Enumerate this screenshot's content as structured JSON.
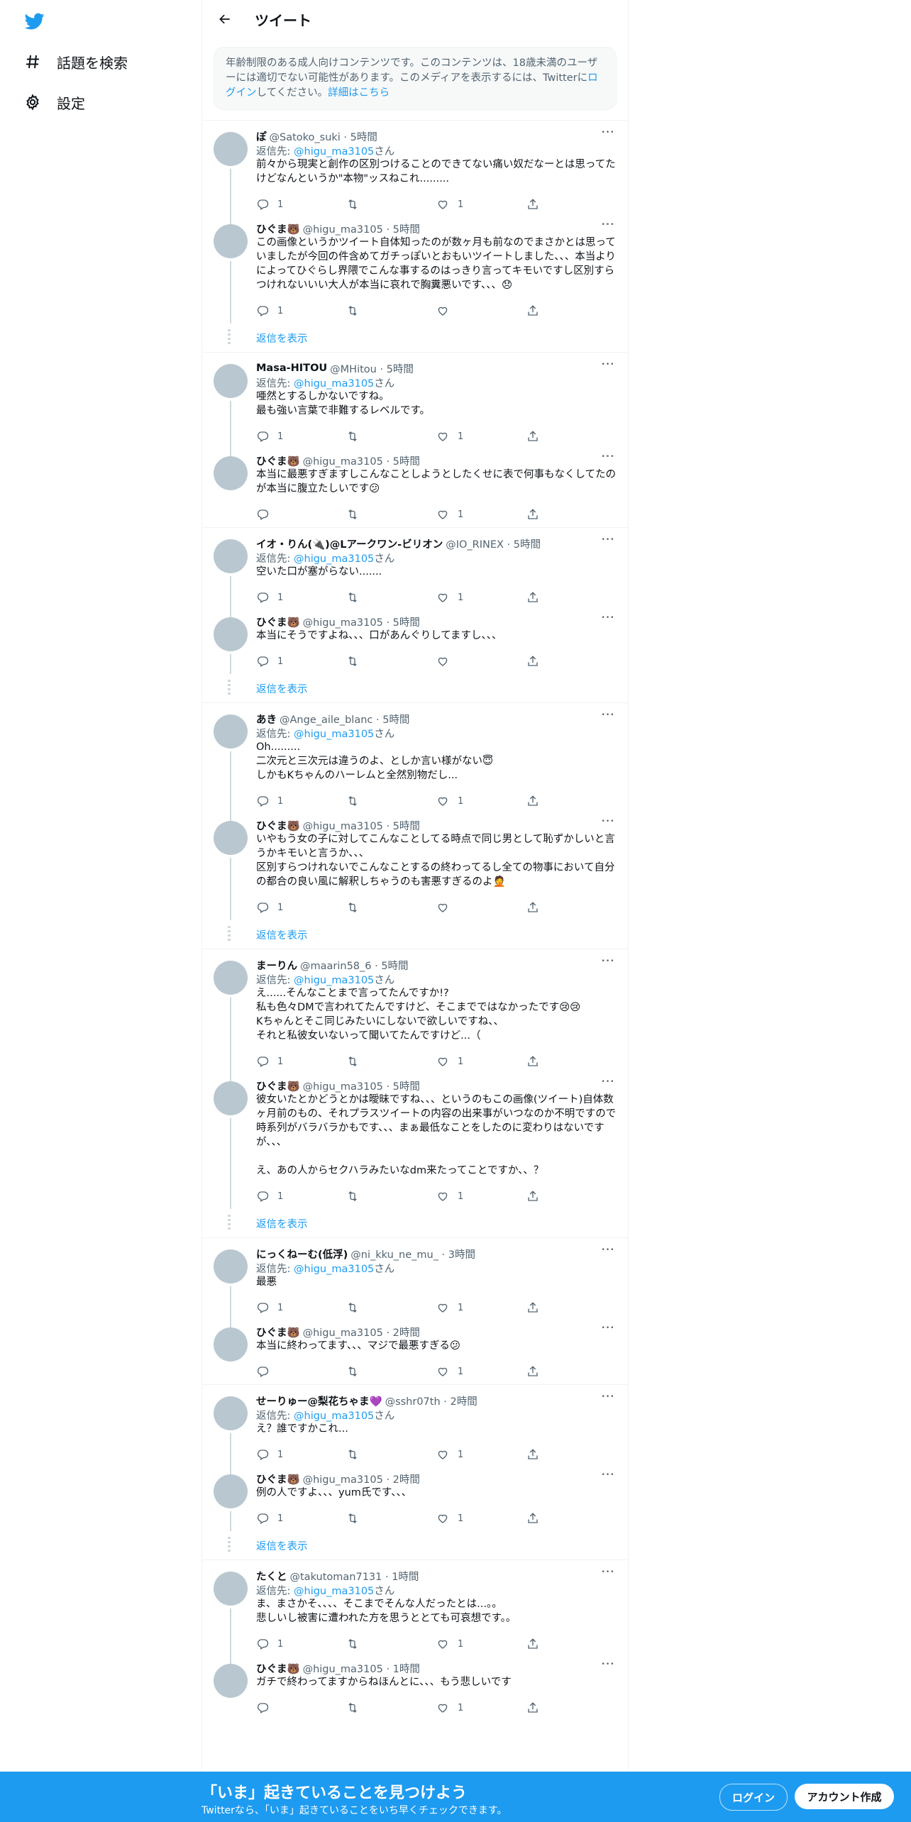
{
  "nav": {
    "search_label": "話題を検索",
    "settings_label": "設定"
  },
  "header": {
    "title": "ツイート"
  },
  "notice": {
    "text": "年齢制限のある成人向けコンテンツです。このコンテンツは、18歳未満のユーザーには適切でない可能性があります。このメディアを表示するには、Twitter",
    "prefix": "に",
    "login_link": "ログイン",
    "middle": "してください。",
    "details_link": "詳細はこちら"
  },
  "reply_prefix": "返信先: ",
  "reply_suffix": "さん",
  "show_replies": "返信を表示",
  "threads": [
    {
      "tweets": [
        {
          "name": "ぽ",
          "handle": "@Satoko_suki · 5時間",
          "reply_to": "@higu_ma3105",
          "text": "前々から現実と創作の区別つけることのできてない痛い奴だなーとは思ってたけどなんというか\"本物\"ッスねこれ.........",
          "reply_count": "1",
          "retweet_count": "",
          "like_count": "1"
        },
        {
          "name": "ひぐま🐻",
          "handle": "@higu_ma3105 · 5時間",
          "text": "この画像というかツイート自体知ったのが数ヶ月も前なのでまさかとは思っていましたが今回の件含めてガチっぽいとおもいツイートしました、、、本当よりによってひぐらし界隈でこんな事するのはっきり言ってキモいですし区別すらつけれないいい大人が本当に哀れで胸糞悪いです、、、😞",
          "reply_count": "1",
          "retweet_count": "",
          "like_count": ""
        }
      ],
      "show_replies": true
    },
    {
      "tweets": [
        {
          "name": "Masa-HITOU",
          "handle": "@MHitou · 5時間",
          "reply_to": "@higu_ma3105",
          "text": "唖然とするしかないですね。\n最も強い言葉で非難するレベルです。",
          "reply_count": "1",
          "retweet_count": "",
          "like_count": "1"
        },
        {
          "name": "ひぐま🐻",
          "handle": "@higu_ma3105 · 5時間",
          "text": "本当に最悪すぎますしこんなことしようとしたくせに表で何事もなくしてたのが本当に腹立たしいです😕",
          "reply_count": "",
          "retweet_count": "",
          "like_count": "1"
        }
      ],
      "show_replies": false
    },
    {
      "tweets": [
        {
          "name": "イオ・りん(🔌)@Lアークワン-ビリオン",
          "handle": "@IO_RINEX · 5時間",
          "reply_to": "@higu_ma3105",
          "text": "空いた口が塞がらない.......",
          "reply_count": "1",
          "retweet_count": "",
          "like_count": "1"
        },
        {
          "name": "ひぐま🐻",
          "handle": "@higu_ma3105 · 5時間",
          "text": "本当にそうですよね、、、口があんぐりしてますし、、、",
          "reply_count": "1",
          "retweet_count": "",
          "like_count": ""
        }
      ],
      "show_replies": true
    },
    {
      "tweets": [
        {
          "name": "あき",
          "handle": "@Ange_aile_blanc · 5時間",
          "reply_to": "@higu_ma3105",
          "text": "Oh.........\n二次元と三次元は違うのよ、としか言い様がない😇\nしかもKちゃんのハーレムと全然別物だし...",
          "reply_count": "1",
          "retweet_count": "",
          "like_count": "1"
        },
        {
          "name": "ひぐま🐻",
          "handle": "@higu_ma3105 · 5時間",
          "text": "いやもう女の子に対してこんなことしてる時点で同じ男として恥ずかしいと言うかキモいと言うか、、、\n区別すらつけれないでこんなことするの終わってるし全ての物事において自分の都合の良い風に解釈しちゃうのも害悪すぎるのよ🤦",
          "reply_count": "1",
          "retweet_count": "",
          "like_count": ""
        }
      ],
      "show_replies": true
    },
    {
      "tweets": [
        {
          "name": "まーりん",
          "handle": "@maarin58_6 · 5時間",
          "reply_to": "@higu_ma3105",
          "text": "え......そんなことまで言ってたんですか!?\n私も色々DMで言われてたんですけど、そこまでではなかったです😢😢\nKちゃんとそこ同じみたいにしないで欲しいですね、、\nそれと私彼女いないって聞いてたんですけど...（",
          "reply_count": "1",
          "retweet_count": "",
          "like_count": "1"
        },
        {
          "name": "ひぐま🐻",
          "handle": "@higu_ma3105 · 5時間",
          "text": "彼女いたとかどうとかは曖昧ですね、、、というのもこの画像(ツイート)自体数ヶ月前のもの、それプラスツイートの内容の出来事がいつなのか不明ですので時系列がバラバラかもです、、、まぁ最低なことをしたのに変わりはないですが、、、\n\nえ、あの人からセクハラみたいなdm来たってことですか、、？",
          "reply_count": "1",
          "retweet_count": "",
          "like_count": "1"
        }
      ],
      "show_replies": true
    },
    {
      "tweets": [
        {
          "name": "にっくねーむ(低浮)",
          "handle": "@ni_kku_ne_mu_ · 3時間",
          "reply_to": "@higu_ma3105",
          "text": "最悪",
          "reply_count": "1",
          "retweet_count": "",
          "like_count": "1"
        },
        {
          "name": "ひぐま🐻",
          "handle": "@higu_ma3105 · 2時間",
          "text": "本当に終わってます、、、マジで最悪すぎる😕",
          "reply_count": "",
          "retweet_count": "",
          "like_count": "1"
        }
      ],
      "show_replies": false
    },
    {
      "tweets": [
        {
          "name": "せーりゅー@梨花ちゃま💜",
          "handle": "@sshr07th · 2時間",
          "reply_to": "@higu_ma3105",
          "text": "え？誰ですかこれ...",
          "reply_count": "1",
          "retweet_count": "",
          "like_count": "1"
        },
        {
          "name": "ひぐま🐻",
          "handle": "@higu_ma3105 · 2時間",
          "text": "例の人ですよ、、、yum氏です、、、",
          "reply_count": "1",
          "retweet_count": "",
          "like_count": "1"
        }
      ],
      "show_replies": true
    },
    {
      "tweets": [
        {
          "name": "たくと",
          "handle": "@takutoman7131 · 1時間",
          "reply_to": "@higu_ma3105",
          "text": "ま、まさかそ、、、、そこまでそんな人だったとは...。。\n悲しいし被害に遭われた方を思うととても可哀想です。。",
          "reply_count": "1",
          "retweet_count": "",
          "like_count": "1"
        },
        {
          "name": "ひぐま🐻",
          "handle": "@higu_ma3105 · 1時間",
          "text": "ガチで終わってますからねほんとに、、、もう悲しいです",
          "reply_count": "",
          "retweet_count": "",
          "like_count": "1"
        }
      ],
      "show_replies": false
    }
  ],
  "bottom_bar": {
    "title": "「いま」起きていることを見つけよう",
    "subtitle": "Twitterなら、「いま」起きていることをいち早くチェックできます。",
    "login_label": "ログイン",
    "signup_label": "アカウント作成"
  },
  "colors": {
    "accent": "#1d9bf0",
    "text": "#0f1419",
    "muted": "#536471"
  }
}
